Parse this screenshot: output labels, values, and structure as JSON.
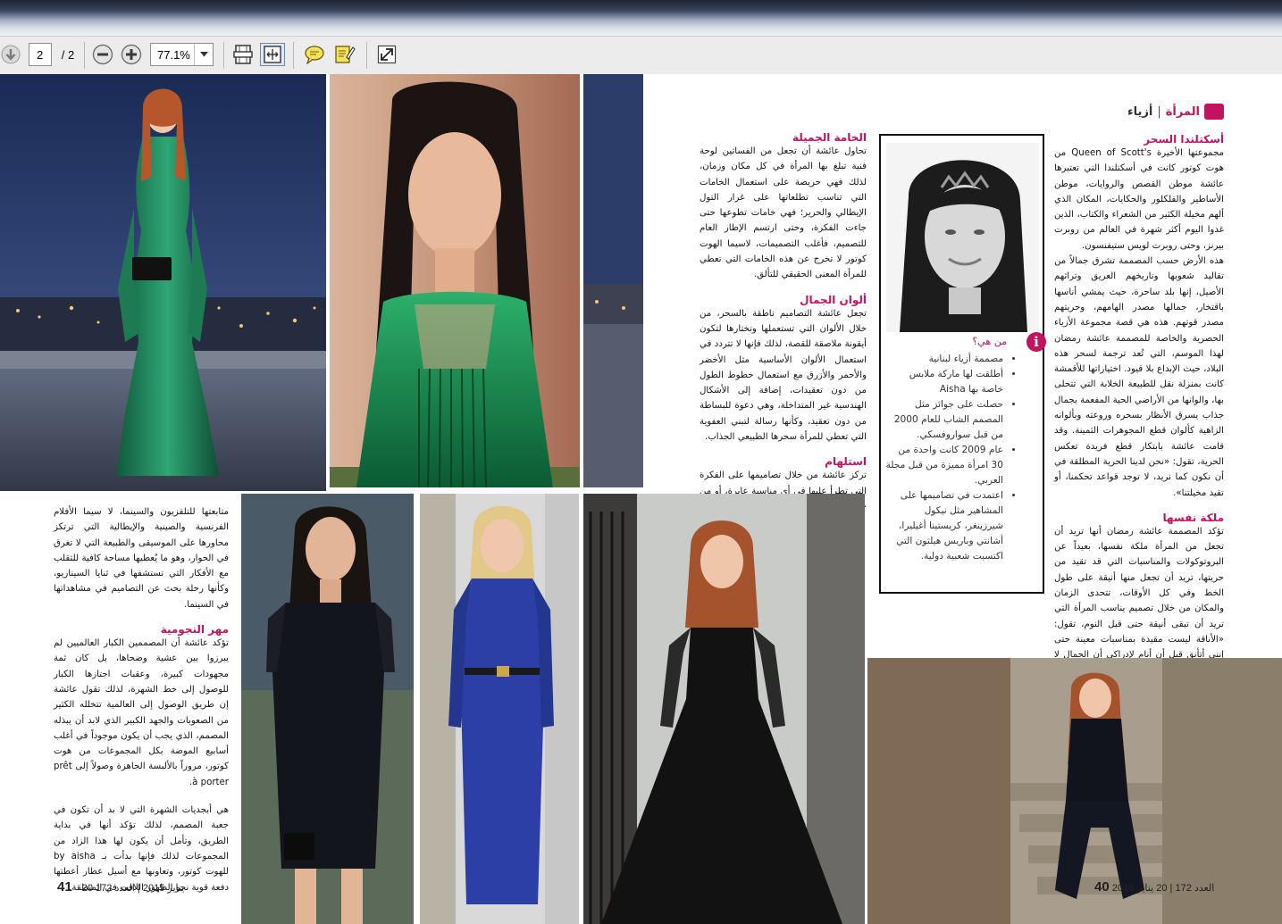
{
  "viewer": {
    "page_current": "2",
    "page_total": "/ 2",
    "zoom": "77.1%",
    "icons": [
      "down-arrow-icon",
      "zoom-out-icon",
      "zoom-in-icon",
      "dropdown-arrow-icon",
      "fit-page-icon",
      "fit-width-icon",
      "comment-icon",
      "highlight-icon",
      "fullscreen-icon"
    ]
  },
  "page_right": {
    "section_label": "المرأة",
    "section_sub": "أزياء",
    "heading1": "أسكتلندا السحر",
    "body1": "مجموعتها الأخيرة Queen of Scott's من هوت كوتور كانت في أسكتلندا التي تعتبرها عائشة موطن القصص والروايات، موطن الأساطير والفلكلور والحكايات، المكان الذي ألهم مخيلة الكثير من الشعراء والكتاب، الذين غدوا اليوم أكثر شهرة في العالم من روبرت بيرنز، وحتى روبرت لويس ستيفنسون.",
    "body2": "هذه الأرض حسب المصممة تشرق جمالاً من تقاليد شعوبها وتاريخهم العريق وتراثهم الأصيل، إنها بلد ساحرة، حيث يمشي أناسها باقتخار، جمالها مصدر الهامهم، وحريتهم مصدر قوتهم. هذه هي قصة مجموعة الأزياء الحصرية والخاصة للمصممة عائشة رمضان لهذا الموسم، التي تُعد ترجمة لسحر هذه البلاد، حيث الإبداع بلا قيود. اختياراتها للأقمشة كانت بمنزلة نقل للطبيعة الخلابة التي تتحلى بها، والوانها من الأراضي الحية المفعمة بجمال جذاب يسرق الأنظار بسحره وروعته وبألوانه الزاهية كألوان قطع المجوهرات الثمينة. وقد قامت عائشة بابتكار قطع فريدة تعكس الحرية، تقول: «نحن لدينا الحرية المطلقة في أن نكون كما نريد، لا توجد قواعد تحكمنا، أو تقيد مخيلتنا».",
    "heading2": "ملكة نفسها",
    "body3": "تؤكد المصممة عائشة رمضان أنها تريد أن تجعل من المرأة ملكة نفسها، بعيداً عن البروتوكولات والمناسبات التي قد تقيد من حريتها، تريد أن تجعل منها أنيقة على طول الخط وفي كل الأوقات، تتحدى الزمان والمكان من خلال تصميم يناسب المرأة التي تريد أن تبقى أنيقة حتى قبل النوم، تقول: «الأناقة ليست مقيدة بمناسبات معينة حتى إنني أتأنق قبل أن أنام لإدراكي أن الجمال لا يمكن أن يقيد باعتبارات معينة، إنه ملازم للمرأة التي تسعى إلى الأناقة؛ فأنا بكل بساطة ملكة نفسي».",
    "folio_number": "40",
    "folio_text": "العدد 172 | 20 يناير 2015"
  },
  "infobox": {
    "title": "من هي؟",
    "items": [
      "مصممة أزياء لبنانية",
      "أطلقت لها ماركة ملابس خاصة بها Aisha",
      "حصلت على جوائز مثل المصمم الشاب للعام 2000 من قبل سواروفسكي.",
      "عام 2009 كانت واحدة من 30 امرأة مميزة من قبل مجلة العربي.",
      "اعتمدت في تصاميمها على المشاهير مثل نيكول شيرزينغر، كريستينا أغيليرا، أشانتي وباريس هيلتون التي اكتسبت شعبية دولية."
    ]
  },
  "page_middle": {
    "heading1": "الخامة الجميلة",
    "body1": "تحاول عائشة أن تجعل من الفساتين لوحة فنية تبلغ بها المرأة في كل مكان وزمان، لذلك فهي حريصة على استعمال الخامات التي تناسب تطلعاتها على غرار التول الإيطالي والحرير؛ فهي خامات تطوعها حتى جاءت الفكرة، وحتى ارتسم الإطار العام للتصميم، فأغلب التصميمات، لاسيما الهوت كوتور لا تخرج عن هذه الخامات التي تعطي للمرأة المعنى الحقيقي للتألق.",
    "heading2": "ألوان الجمال",
    "body2": "تجعل عائشة التصاميم ناطقة بالسحر، من خلال الألوان التي تستعملها وتختارها لتكون أيقونة ملاصقة للقصة، لذلك فإنها لا تتردد في استعمال الألوان الأساسية مثل الأخضر والأحمر والأزرق مع استعمال خطوط الطول من دون تعقيدات، إضافة إلى الأشكال الهندسية غير المتداخلة، وهي دعوة للبساطة من دون تعقيد، وكأنها رسالة لتبني العفوية التي تعطي للمرأة سحرها الطبيعي الجذاب.",
    "heading3": "استلهام",
    "body3": "تركز عائشة من خلال تصاميمها على الفكرة التي تطرأ عليها في أي مناسبة عابرة، أو من خلال"
  },
  "page_left": {
    "body1": "متابعتها للتلفزيون والسينما، لا سيما الأفلام الفرنسية والصينية والإيطالية التي ترتكز محاورها على الموسيقى والطبيعة التي لا تغرق في الحوار، وهو ما يُعطيها مساحة كافية للتقلب مع الأفكار التي تستشفها في ثنايا السيناريو، وكأنها رحلة بحث عن التصاميم في مشاهداتها في السينما.",
    "heading1": "مهر النجومية",
    "body2": "تؤكد عائشة أن المصممين الكبار العالميين لم يبرزوا بين عشية وضحاها، بل كان ثمة مجهودات كبيرة، وعقبات اجتازها الكبار للوصول إلى خط الشهرة، لذلك تقول عائشة إن طريق الوصول إلى العالمية تتخلله الكثير من الصعوبات والجهد الكبير الذي لابد أن يبذله المصمم، الذي يجب أن يكون موجوداً في أغلب أسابيع الموضة بكل المجموعات من هوت كوتور، مروراً بالألبسة الجاهزة وصولاً إلى prêt à porter.",
    "body3": "هي أبجديات الشهرة التي لا بد أن تكون في جعبة المصمم، لذلك تؤكد أنها في بداية الطريق، وتأمل أن يكون لها هذا الزاد من المجموعات لذلك فإنها بدأت بـ by aisha للهوت كوتور، وتعاونها مع أسيل عطار أعطتها دفعة قوية نحو الظهور اللافت في المنطقة.",
    "folio_number": "41",
    "folio_text": "20 يناير 2015 | العدد 172"
  },
  "colors": {
    "accent_magenta": "#c2135f",
    "toolbar_bg": "#ececec",
    "emerald_dress": "#1f8a5b",
    "royal_blue_dress": "#2b3fa6",
    "black_dress": "#121212",
    "twilight_sky": "#2b3c6a"
  }
}
